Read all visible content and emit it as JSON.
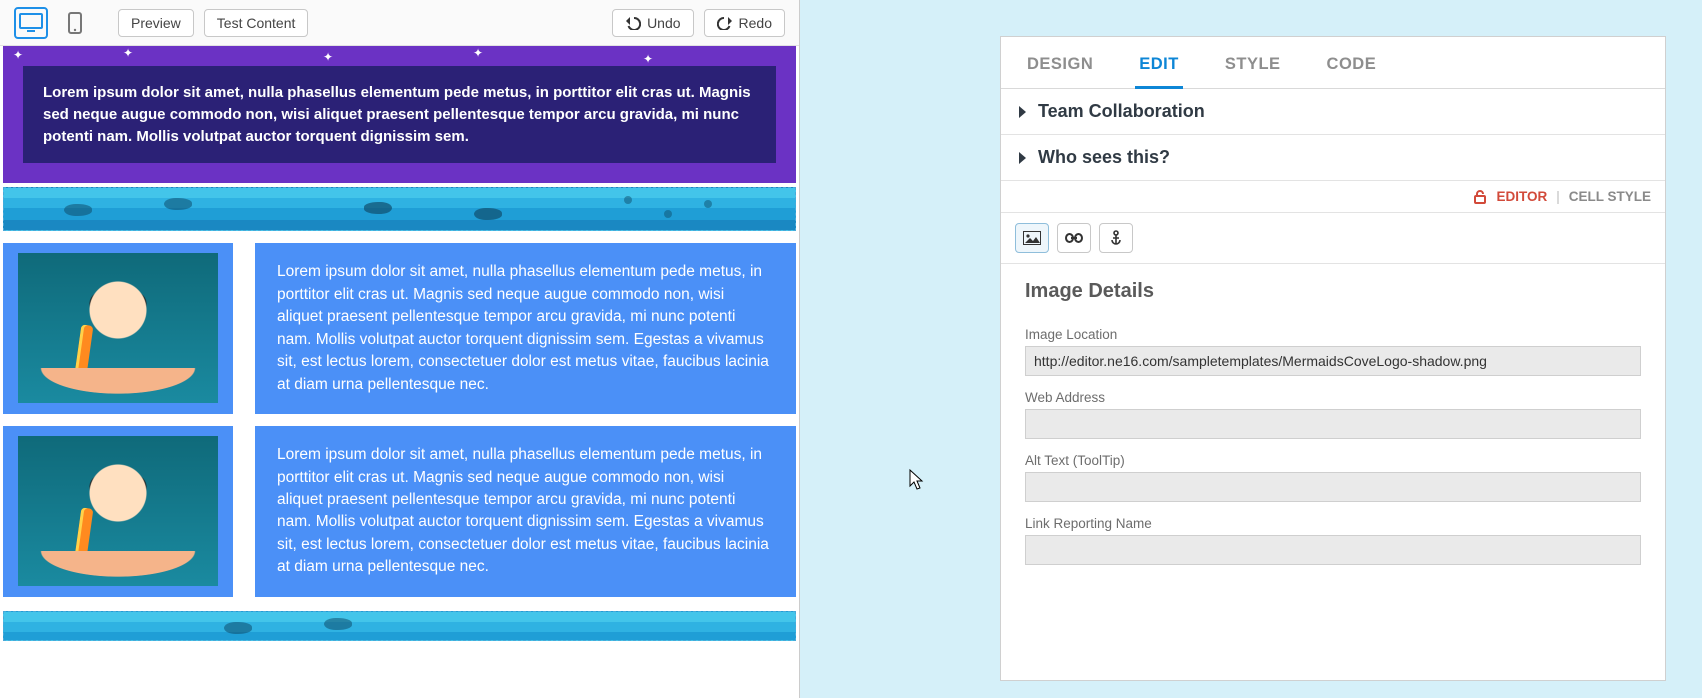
{
  "toolbar": {
    "preview_label": "Preview",
    "test_label": "Test Content",
    "undo_label": "Undo",
    "redo_label": "Redo"
  },
  "hero": {
    "text": "Lorem ipsum dolor sit amet, nulla phasellus elementum pede metus, in porttitor elit cras ut. Magnis sed neque augue commodo non, wisi aliquet praesent pellentesque tempor arcu gravida, mi nunc potenti nam. Mollis volutpat auctor torquent dignissim sem."
  },
  "blocks": {
    "b1": "Lorem ipsum dolor sit amet, nulla phasellus elementum pede metus, in porttitor elit cras ut. Magnis sed neque augue commodo non, wisi aliquet praesent pellentesque tempor arcu gravida, mi nunc potenti nam. Mollis volutpat auctor torquent dignissim sem. Egestas a vivamus sit, est lectus lorem, consectetuer dolor est metus vitae, faucibus lacinia at diam urna pellentesque nec.",
    "b2": "Lorem ipsum dolor sit amet, nulla phasellus elementum pede metus, in porttitor elit cras ut. Magnis sed neque augue commodo non, wisi aliquet praesent pellentesque tempor arcu gravida, mi nunc potenti nam. Mollis volutpat auctor torquent dignissim sem. Egestas a vivamus sit, est lectus lorem, consectetuer dolor est metus vitae, faucibus lacinia at diam urna pellentesque nec."
  },
  "tabs": {
    "design": "DESIGN",
    "edit": "EDIT",
    "style": "STYLE",
    "code": "CODE"
  },
  "accordions": {
    "team": "Team Collaboration",
    "who": "Who sees this?"
  },
  "mode": {
    "editor": "EDITOR",
    "cell": "CELL STYLE"
  },
  "section": {
    "title": "Image Details"
  },
  "fields": {
    "image_location_label": "Image Location",
    "image_location_value": "http://editor.ne16.com/sampletemplates/MermaidsCoveLogo-shadow.png",
    "web_address_label": "Web Address",
    "web_address_value": "",
    "alt_text_label": "Alt Text (ToolTip)",
    "alt_text_value": "",
    "link_name_label": "Link Reporting Name",
    "link_name_value": ""
  }
}
